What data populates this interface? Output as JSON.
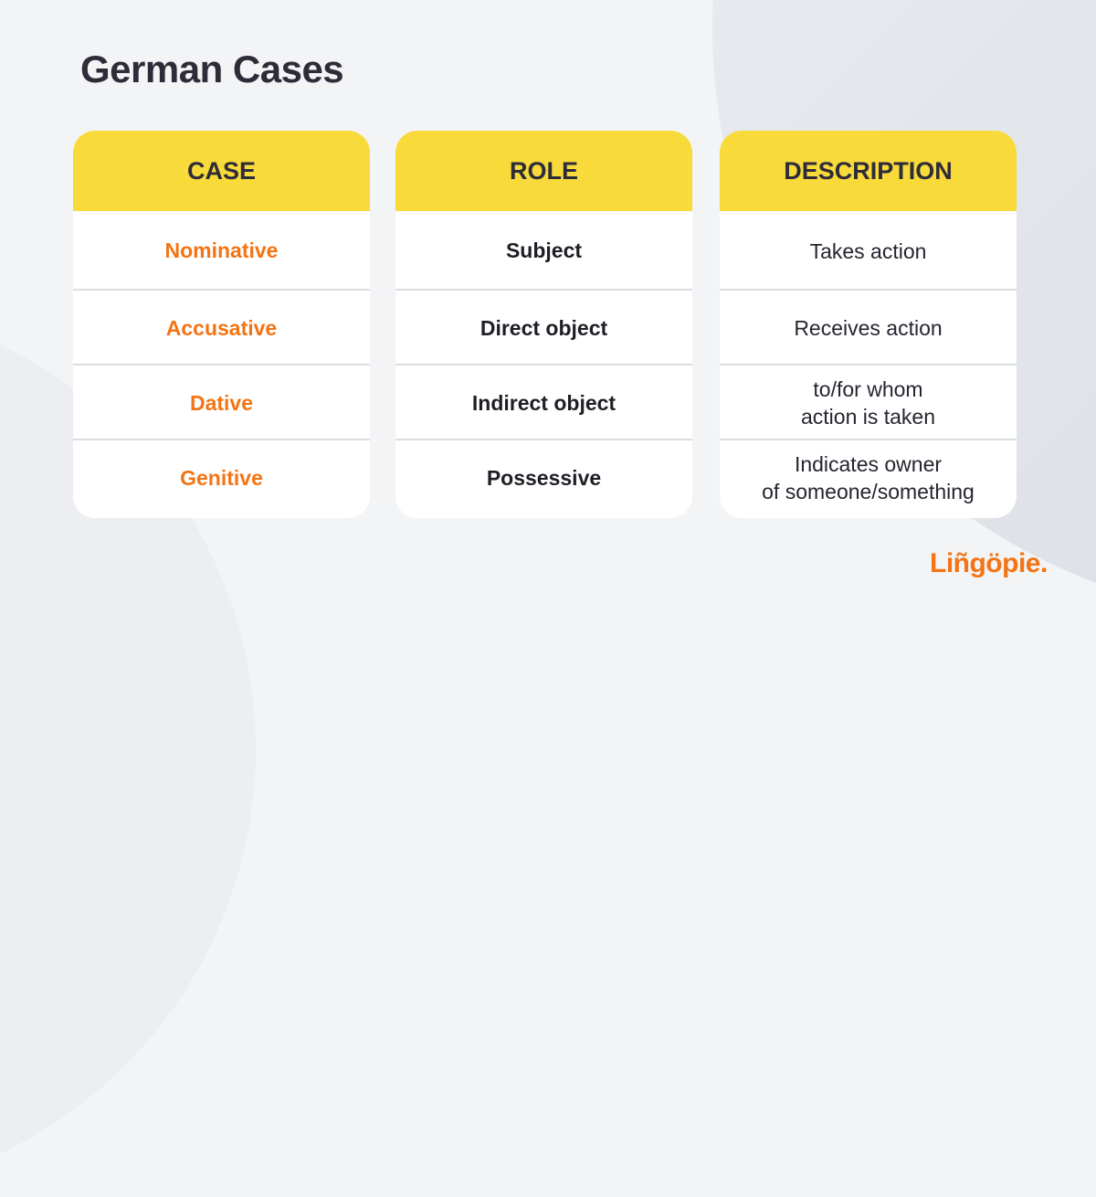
{
  "title": "German Cases",
  "columns": [
    {
      "header": "CASE"
    },
    {
      "header": "ROLE"
    },
    {
      "header": "DESCRIPTION"
    }
  ],
  "rows": [
    {
      "case": "Nominative",
      "role": "Subject",
      "description": [
        "Takes action"
      ]
    },
    {
      "case": "Accusative",
      "role": "Direct object",
      "description": [
        "Receives action"
      ]
    },
    {
      "case": "Dative",
      "role": "Indirect object",
      "description": [
        "to/for whom",
        "action is taken"
      ]
    },
    {
      "case": "Genitive",
      "role": "Possessive",
      "description": [
        "Indicates owner",
        "of someone/something"
      ]
    }
  ],
  "logo": "Liñgöpie.",
  "colors": {
    "accent_orange": "#f37414",
    "header_yellow": "#f8da3a",
    "text_dark": "#2e2c38",
    "background": "#f3f4f6"
  }
}
